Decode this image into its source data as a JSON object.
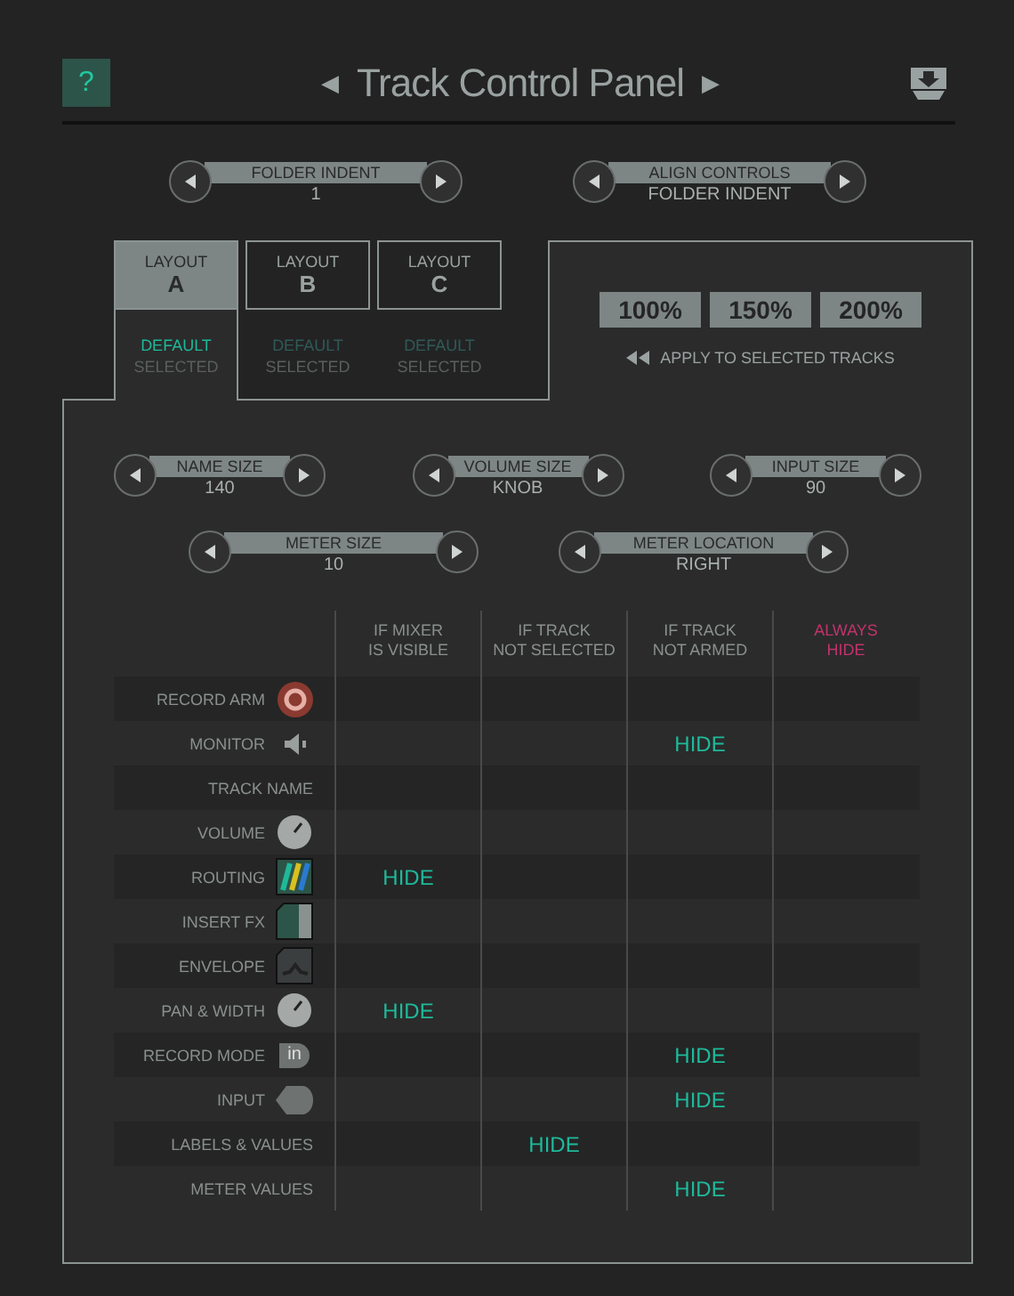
{
  "header": {
    "help": "?",
    "title": "Track Control Panel",
    "prev": "◀",
    "next": "▶"
  },
  "top_steppers": [
    {
      "label": "FOLDER INDENT",
      "value": "1"
    },
    {
      "label": "ALIGN CONTROLS",
      "value": "FOLDER INDENT"
    }
  ],
  "layouts": [
    {
      "label": "LAYOUT",
      "letter": "A",
      "selected": true,
      "default_label": "DEFAULT",
      "is_default": true,
      "status": "SELECTED"
    },
    {
      "label": "LAYOUT",
      "letter": "B",
      "selected": false,
      "default_label": "DEFAULT",
      "is_default": false,
      "status": "SELECTED"
    },
    {
      "label": "LAYOUT",
      "letter": "C",
      "selected": false,
      "default_label": "DEFAULT",
      "is_default": false,
      "status": "SELECTED"
    }
  ],
  "scales": [
    "100%",
    "150%",
    "200%"
  ],
  "apply": "APPLY TO SELECTED TRACKS",
  "steppers_row1": [
    {
      "label": "NAME SIZE",
      "value": "140"
    },
    {
      "label": "VOLUME SIZE",
      "value": "KNOB"
    },
    {
      "label": "INPUT SIZE",
      "value": "90"
    }
  ],
  "steppers_row2": [
    {
      "label": "METER SIZE",
      "value": "10"
    },
    {
      "label": "METER LOCATION",
      "value": "RIGHT"
    }
  ],
  "columns": [
    {
      "kind": "condition",
      "line1": "IF MIXER",
      "line2": "IS VISIBLE"
    },
    {
      "kind": "condition",
      "line1": "IF TRACK",
      "line2": "NOT SELECTED"
    },
    {
      "kind": "condition",
      "line1": "IF TRACK",
      "line2": "NOT ARMED"
    },
    {
      "kind": "always",
      "line1": "ALWAYS",
      "line2": "HIDE"
    }
  ],
  "rows": [
    {
      "label": "RECORD ARM",
      "kind": "record",
      "cells": [
        {},
        {},
        {},
        {}
      ]
    },
    {
      "label": "MONITOR",
      "kind": "speaker",
      "cells": [
        {},
        {},
        {
          "text": "HIDE"
        },
        {}
      ]
    },
    {
      "label": "TRACK NAME",
      "kind": "none",
      "cells": [
        {},
        {},
        {},
        {}
      ]
    },
    {
      "label": "VOLUME",
      "kind": "knob",
      "cells": [
        {},
        {},
        {},
        {}
      ]
    },
    {
      "label": "ROUTING",
      "kind": "routing",
      "cells": [
        {
          "text": "HIDE"
        },
        {},
        {},
        {}
      ]
    },
    {
      "label": "INSERT FX",
      "kind": "fx",
      "cells": [
        {},
        {},
        {},
        {}
      ]
    },
    {
      "label": "ENVELOPE",
      "kind": "envelope",
      "cells": [
        {},
        {},
        {},
        {}
      ]
    },
    {
      "label": "PAN & WIDTH",
      "kind": "knob",
      "cells": [
        {
          "text": "HIDE"
        },
        {},
        {},
        {}
      ]
    },
    {
      "label": "RECORD MODE",
      "kind": "mode",
      "icon_text": "in",
      "cells": [
        {},
        {},
        {
          "text": "HIDE"
        },
        {}
      ]
    },
    {
      "label": "INPUT",
      "kind": "input",
      "cells": [
        {},
        {},
        {
          "text": "HIDE"
        },
        {}
      ]
    },
    {
      "label": "LABELS & VALUES",
      "kind": "none",
      "cells": [
        {},
        {
          "text": "HIDE"
        },
        {},
        {}
      ]
    },
    {
      "label": "METER VALUES",
      "kind": "none",
      "cells": [
        {},
        {},
        {
          "text": "HIDE"
        },
        {}
      ]
    }
  ]
}
